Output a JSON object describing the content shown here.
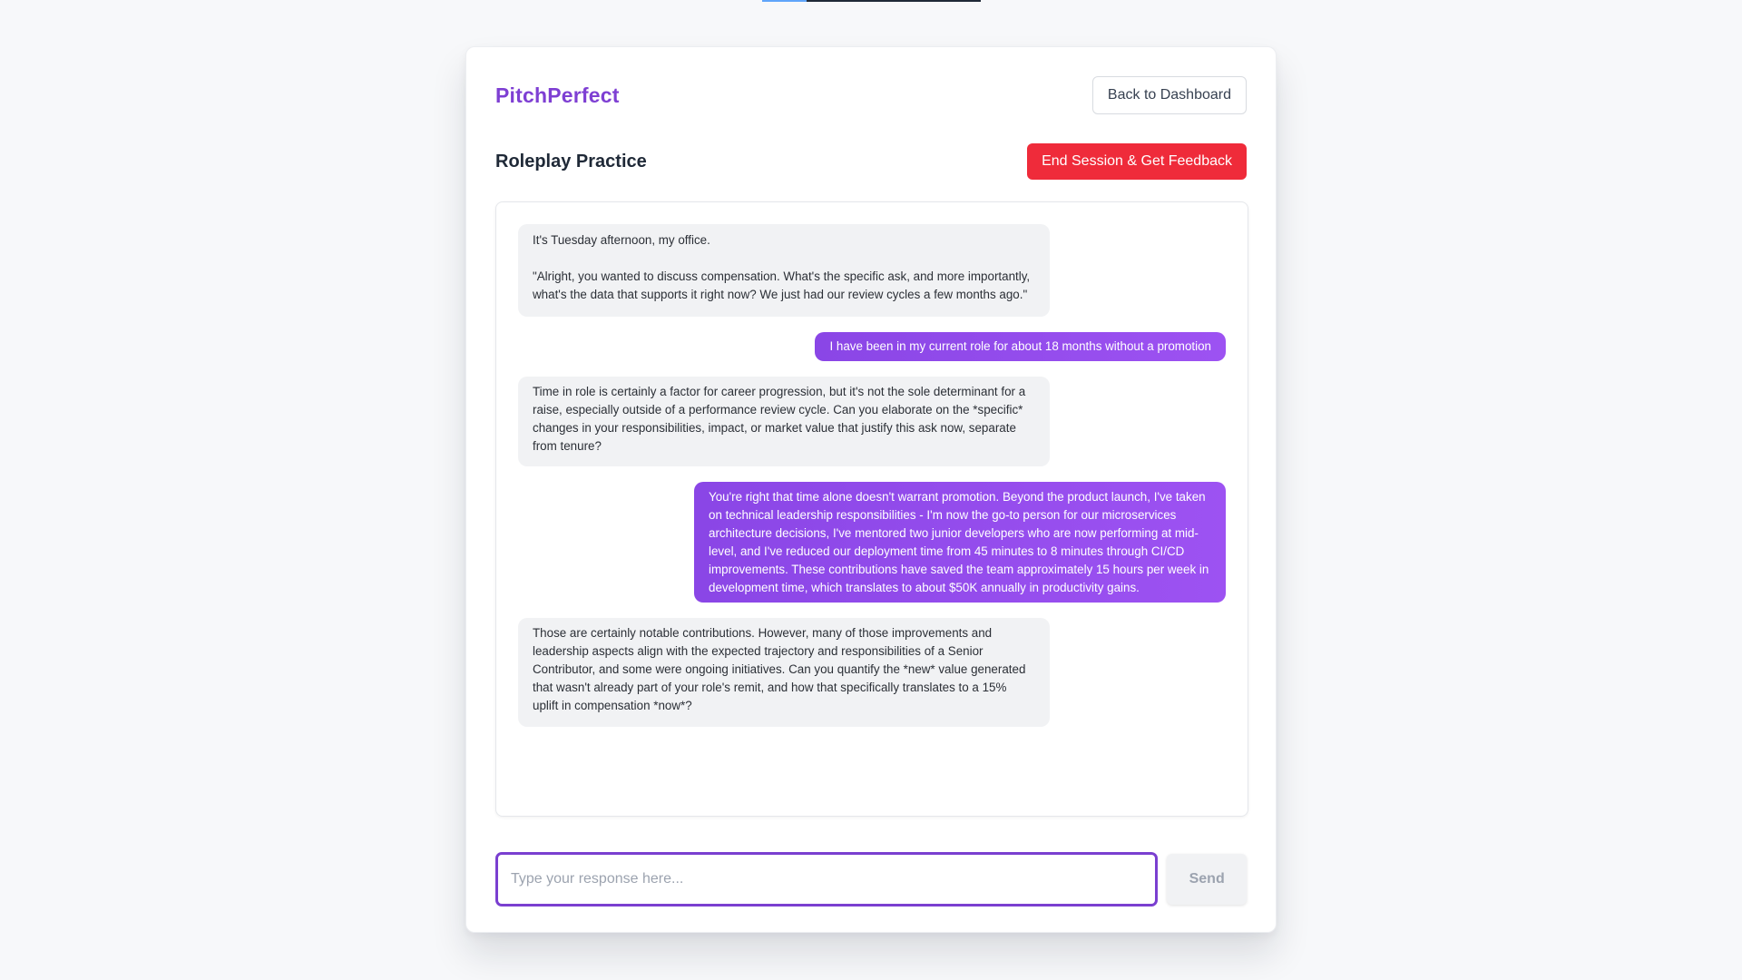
{
  "app": {
    "brand": "PitchPerfect"
  },
  "header": {
    "back_label": "Back to Dashboard"
  },
  "session": {
    "title": "Roleplay Practice",
    "end_label": "End Session & Get Feedback"
  },
  "messages": [
    {
      "role": "ai",
      "text": "It's Tuesday afternoon, my office.\n\n\"Alright, you wanted to discuss compensation. What's the specific ask, and more importantly, what's the data that supports it right now? We just had our review cycles a few months ago.\""
    },
    {
      "role": "user",
      "text": "I have been in my current role for about 18 months without a promotion"
    },
    {
      "role": "ai",
      "text": "Time in role is certainly a factor for career progression, but it's not the sole determinant for a raise, especially outside of a performance review cycle. Can you elaborate on the *specific* changes in your responsibilities, impact, or market value that justify this ask now, separate from tenure?"
    },
    {
      "role": "user",
      "text": "You're right that time alone doesn't warrant promotion. Beyond the product launch, I've taken on technical leadership responsibilities - I'm now the go-to person for our microservices architecture decisions, I've mentored two junior developers who are now performing at mid-level, and I've reduced our deployment time from 45 minutes to 8 minutes through CI/CD improvements. These contributions have saved the team approximately 15 hours per week in development time, which translates to about $50K annually in productivity gains."
    },
    {
      "role": "ai",
      "text": "Those are certainly notable contributions. However, many of those improvements and leadership aspects align with the expected trajectory and responsibilities of a Senior Contributor, and some were ongoing initiatives. Can you quantify the *new* value generated that wasn't already part of your role's remit, and how that specifically translates to a 15% uplift in compensation *now*?"
    }
  ],
  "composer": {
    "value": "",
    "placeholder": "Type your response here...",
    "send_label": "Send"
  },
  "colors": {
    "brand": "#7e3fd3",
    "danger": "#ef2b3a",
    "user_bubble": "#9049ea",
    "ai_bubble": "#f1f2f4"
  }
}
